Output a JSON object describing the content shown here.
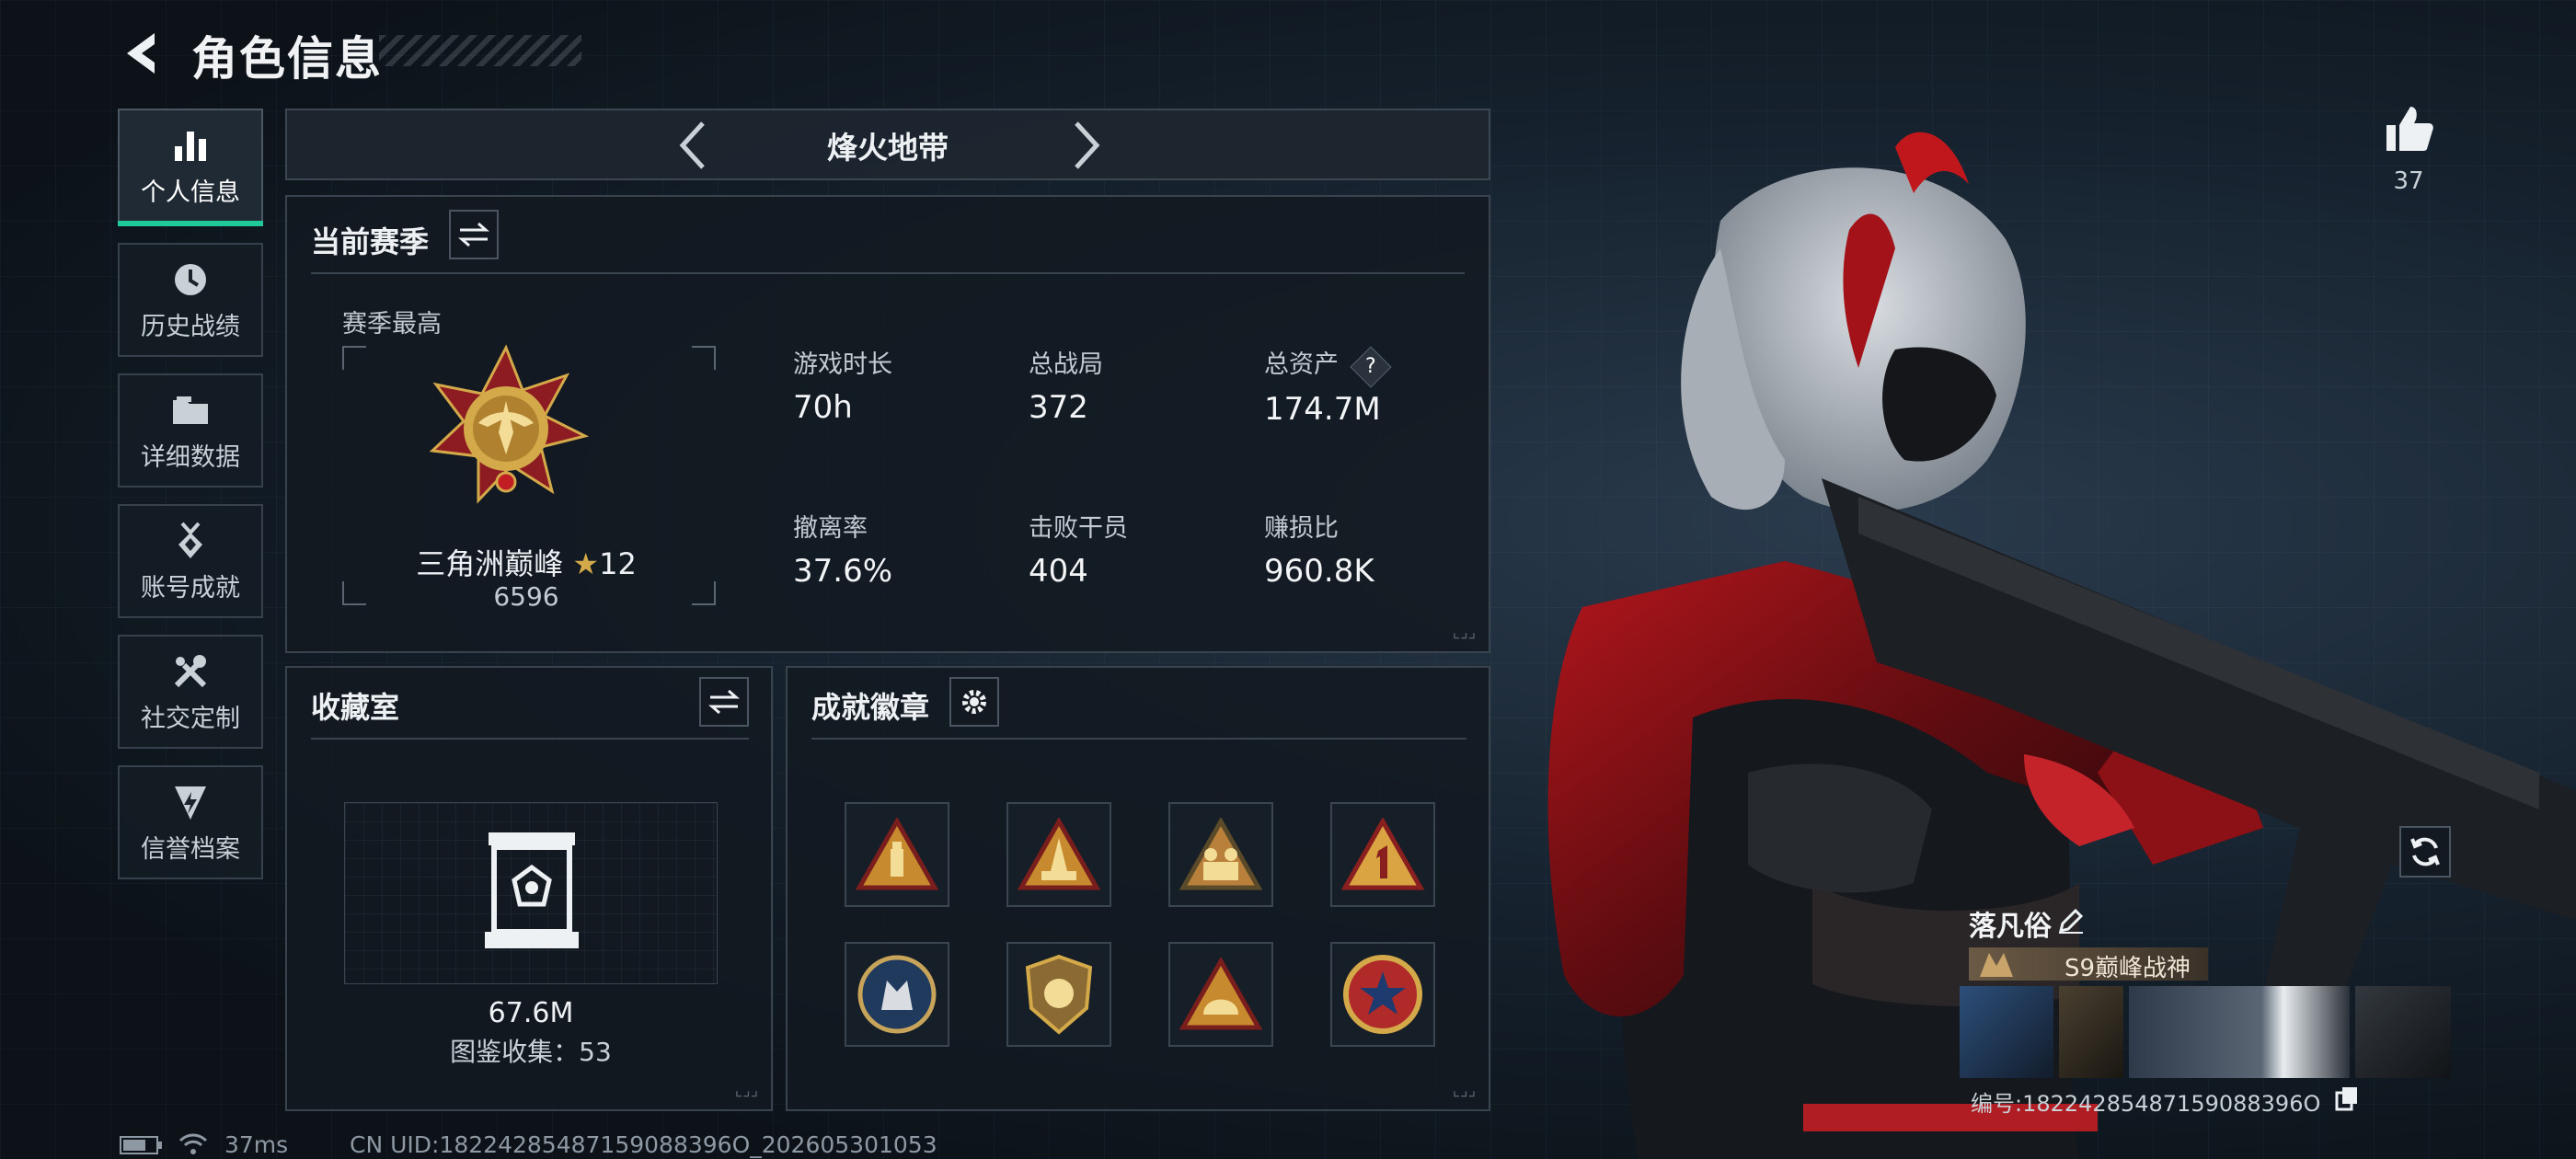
{
  "header": {
    "title": "角色信息"
  },
  "sidebar": {
    "items": [
      {
        "label": "个人信息",
        "icon": "bar-chart-icon",
        "active": true
      },
      {
        "label": "历史战绩",
        "icon": "history-clock-icon",
        "active": false
      },
      {
        "label": "详细数据",
        "icon": "folder-icon",
        "active": false
      },
      {
        "label": "账号成就",
        "icon": "medal-icon",
        "active": false
      },
      {
        "label": "社交定制",
        "icon": "tools-icon",
        "active": false
      },
      {
        "label": "信誉档案",
        "icon": "shield-bolt-icon",
        "active": false
      }
    ]
  },
  "mode": {
    "name": "烽火地带"
  },
  "season": {
    "title": "当前赛季",
    "best_label": "赛季最高",
    "rank_name": "三角洲巅峰",
    "rank_stars": "12",
    "rank_score": "6596",
    "stats": [
      {
        "label": "游戏时长",
        "value": "70h"
      },
      {
        "label": "总战局",
        "value": "372"
      },
      {
        "label": "总资产",
        "value": "174.7M",
        "help": "?"
      },
      {
        "label": "撤离率",
        "value": "37.6%"
      },
      {
        "label": "击败干员",
        "value": "404"
      },
      {
        "label": "赚损比",
        "value": "960.8K"
      }
    ]
  },
  "collection": {
    "title": "收藏室",
    "value": "67.6M",
    "count_text": "图鉴收集：53"
  },
  "achievements": {
    "title": "成就徽章",
    "badges": [
      "triangle-ammo-badge",
      "triangle-rocket-badge",
      "triangle-squad-badge",
      "triangle-number-one-badge",
      "round-wolf-badge",
      "shield-fist-badge",
      "triangle-helmet-badge",
      "round-star-badge"
    ]
  },
  "likes": {
    "count": "37"
  },
  "player": {
    "name": "落凡俗",
    "title_badge": "S9巅峰战神",
    "id_text": "编号:18224285487159088396O"
  },
  "status_bar": {
    "ping": "37ms",
    "uid": "CN UID:18224285487159088396O_202605301053"
  },
  "colors": {
    "accent": "#1fc99a",
    "panel_border": "#39434e",
    "gold": "#d4a94a",
    "red": "#c21d22"
  }
}
